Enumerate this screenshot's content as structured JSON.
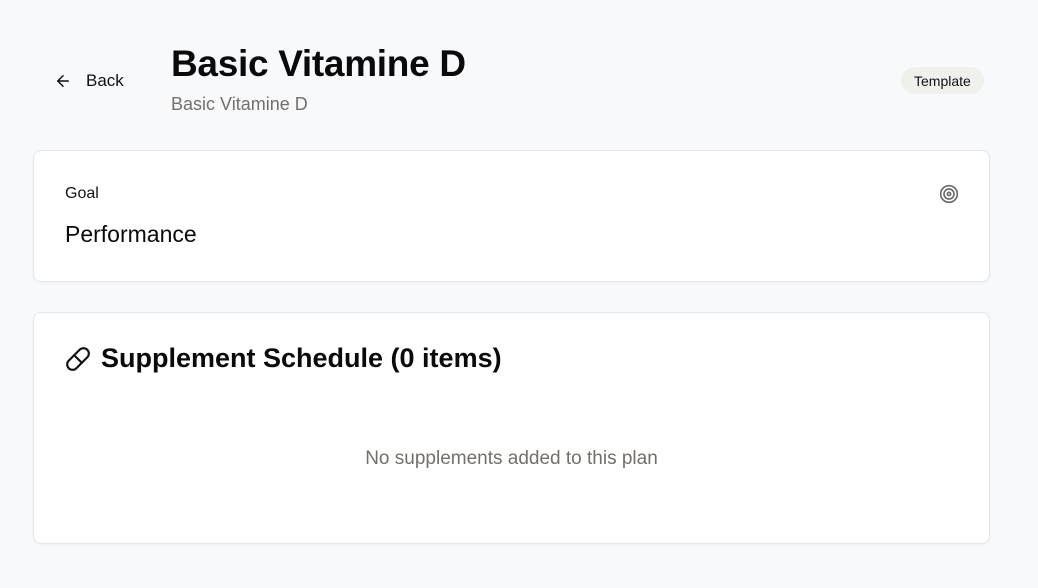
{
  "header": {
    "back_label": "Back",
    "title": "Basic Vitamine D",
    "subtitle": "Basic Vitamine D",
    "badge": "Template"
  },
  "goal": {
    "label": "Goal",
    "value": "Performance",
    "icon": "target-icon"
  },
  "schedule": {
    "icon": "pill-icon",
    "title": "Supplement Schedule (0 items)",
    "empty_message": "No supplements added to this plan"
  }
}
